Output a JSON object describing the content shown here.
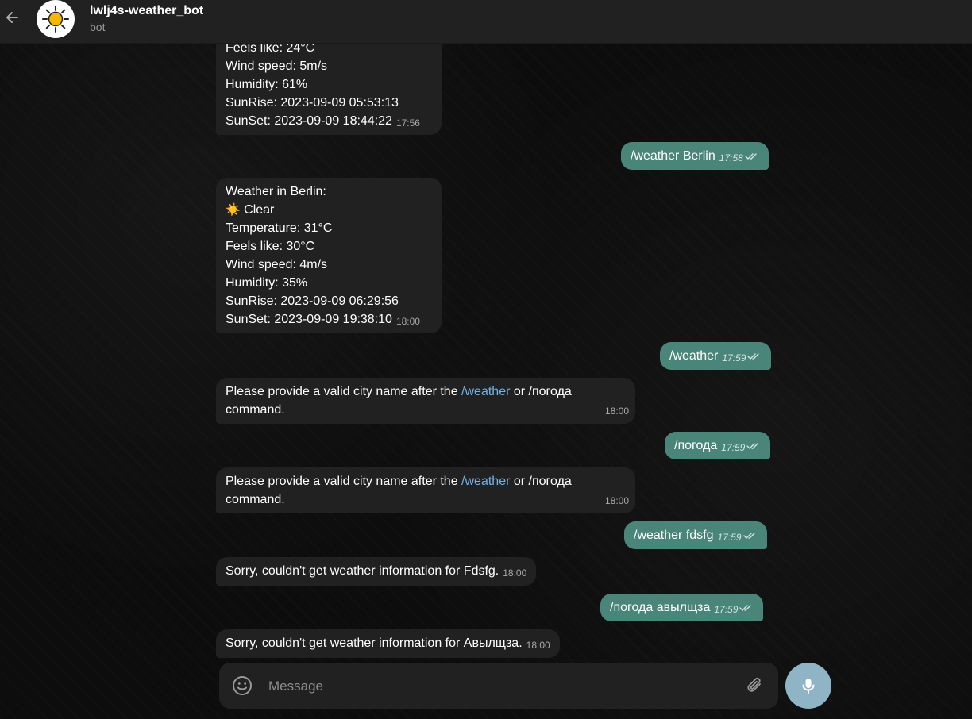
{
  "header": {
    "title": "lwlj4s-weather_bot",
    "subtitle": "bot",
    "avatar_emoji": "☀️"
  },
  "messages": [
    {
      "id": "m1",
      "direction": "in",
      "lines": [
        "Feels like: 24°C",
        "Wind speed: 5m/s",
        "Humidity: 61%",
        "SunRise: 2023-09-09 05:53:13",
        "SunSet: 2023-09-09 18:44:22"
      ],
      "time": "17:56"
    },
    {
      "id": "m2",
      "direction": "out",
      "text": "/weather Berlin",
      "time": "17:58"
    },
    {
      "id": "m3",
      "direction": "in",
      "lines": [
        "Weather in Berlin:",
        "Clear",
        "Temperature: 31°C",
        "Feels like: 30°C",
        "Wind speed: 4m/s",
        "Humidity: 35%",
        "SunRise: 2023-09-09 06:29:56",
        "SunSet: 2023-09-09 19:38:10"
      ],
      "weather_emoji": "☀️",
      "time": "18:00"
    },
    {
      "id": "m4",
      "direction": "out",
      "text": "/weather",
      "time": "17:59"
    },
    {
      "id": "m5",
      "direction": "in",
      "text_before": "Please provide a valid city name after the ",
      "link": "/weather",
      "text_after": " or /погода",
      "line2": "command.",
      "time": "18:00"
    },
    {
      "id": "m6",
      "direction": "out",
      "text": "/погода",
      "time": "17:59"
    },
    {
      "id": "m7",
      "direction": "in",
      "text_before": "Please provide a valid city name after the ",
      "link": "/weather",
      "text_after": " or /погода",
      "line2": "command.",
      "time": "18:00"
    },
    {
      "id": "m8",
      "direction": "out",
      "text": "/weather fdsfg",
      "time": "17:59"
    },
    {
      "id": "m9",
      "direction": "in",
      "text": "Sorry, couldn't get weather information for Fdsfg.",
      "time": "18:00"
    },
    {
      "id": "m10",
      "direction": "out",
      "text": "/погода авылщза",
      "time": "17:59"
    },
    {
      "id": "m11",
      "direction": "in",
      "text": "Sorry, couldn't get weather information for Авылщза.",
      "time": "18:00"
    }
  ],
  "composer": {
    "placeholder": "Message"
  },
  "colors": {
    "incoming_bubble": "#212121",
    "outgoing_bubble": "#4a857a",
    "link": "#6eb3e8",
    "mic_button": "#8fb4c6"
  },
  "icons": {
    "back": "arrow-left-icon",
    "emoji": "smile-icon",
    "attach": "paperclip-icon",
    "mic": "microphone-icon",
    "read": "double-check-icon"
  }
}
